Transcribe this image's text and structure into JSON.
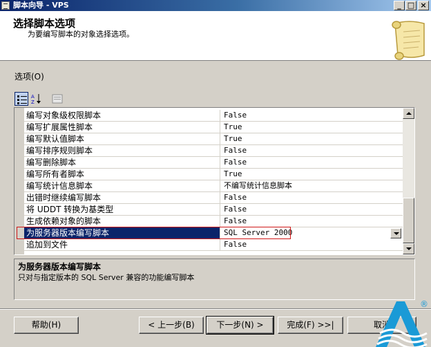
{
  "window": {
    "title": "脚本向导 - VPS",
    "minimize": "_",
    "maximize": "□",
    "close": "×"
  },
  "header": {
    "title": "选择脚本选项",
    "subtitle": "为要编写脚本的对象选择选项。"
  },
  "options_label": "选项(O)",
  "grid": {
    "rows": [
      {
        "name": "编写对象级权限脚本",
        "value": "False"
      },
      {
        "name": "编写扩展属性脚本",
        "value": "True"
      },
      {
        "name": "编写默认值脚本",
        "value": "True"
      },
      {
        "name": "编写排序规则脚本",
        "value": "False"
      },
      {
        "name": "编写删除脚本",
        "value": "False"
      },
      {
        "name": "编写所有者脚本",
        "value": "True"
      },
      {
        "name": "编写统计信息脚本",
        "value": "不编写统计信息脚本"
      },
      {
        "name": "出错时继续编写脚本",
        "value": "False"
      },
      {
        "name": "将 UDDT 转换为基类型",
        "value": "False"
      },
      {
        "name": "生成依赖对象的脚本",
        "value": "False"
      },
      {
        "name": "为服务器版本编写脚本",
        "value": "SQL Server 2000"
      },
      {
        "name": "追加到文件",
        "value": "False"
      }
    ],
    "selected_index": 10
  },
  "description": {
    "title": "为服务器版本编写脚本",
    "text": "只对与指定版本的 SQL Server 兼容的功能编写脚本"
  },
  "buttons": {
    "help": "帮助(H)",
    "back": "< 上一步(B)",
    "next": "下一步(N) >",
    "finish": "完成(F) >>|",
    "cancel": "取消"
  },
  "logo": {
    "registered": "®",
    "accent": "#1a9ad6"
  }
}
